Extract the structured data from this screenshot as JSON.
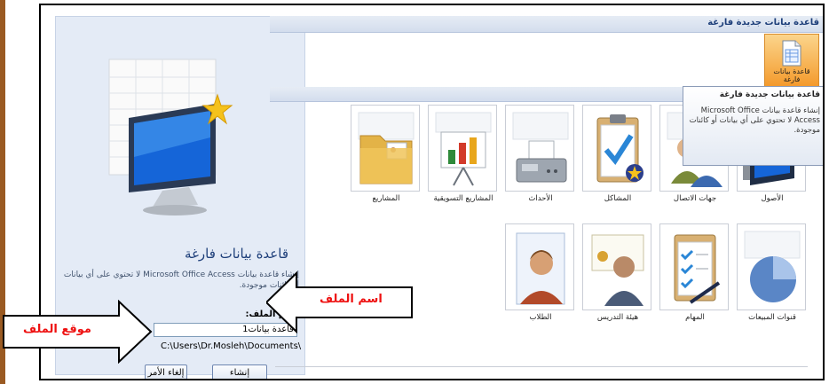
{
  "left_panel": {
    "title": "قاعدة بيانات فارغة",
    "description": "إنشاء قاعدة بيانات Microsoft Office Access لا تحتوي على أي بيانات أو كائنات موجودة.",
    "file_name_label": "إسم الملف:",
    "file_name_value": "قاعدة بيانات1",
    "file_location": "C:\\Users\\Dr.Mosleh\\Documents\\",
    "create_button": "إنشاء",
    "cancel_button": "إلغاء الأمر"
  },
  "right_pane": {
    "section_title": "قاعدة بيانات جديدة فارغة",
    "blank_db_button": "قاعدة بيانات فارغة",
    "tooltip": {
      "title": "قاعدة بيانات جديدة فارغة",
      "body": "إنشاء قاعدة بيانات Microsoft Office Access لا تحتوي على أي بيانات أو كائنات موجودة."
    },
    "templates_row1": [
      "الأصول",
      "جهات الاتصال",
      "المشاكل",
      "الأحداث",
      "المشاريع التسويقية",
      "المشاريع"
    ],
    "templates_row2": [
      "قنوات المبيعات",
      "المهام",
      "هيئة التدريس",
      "الطلاب"
    ]
  },
  "annotations": {
    "file_name_callout": "اسم الملف",
    "file_location_callout": "موقع الملف"
  },
  "colors": {
    "accent_orange": "#f49a2c",
    "header_blue": "#1e3f7a",
    "callout_red": "#e11111"
  }
}
